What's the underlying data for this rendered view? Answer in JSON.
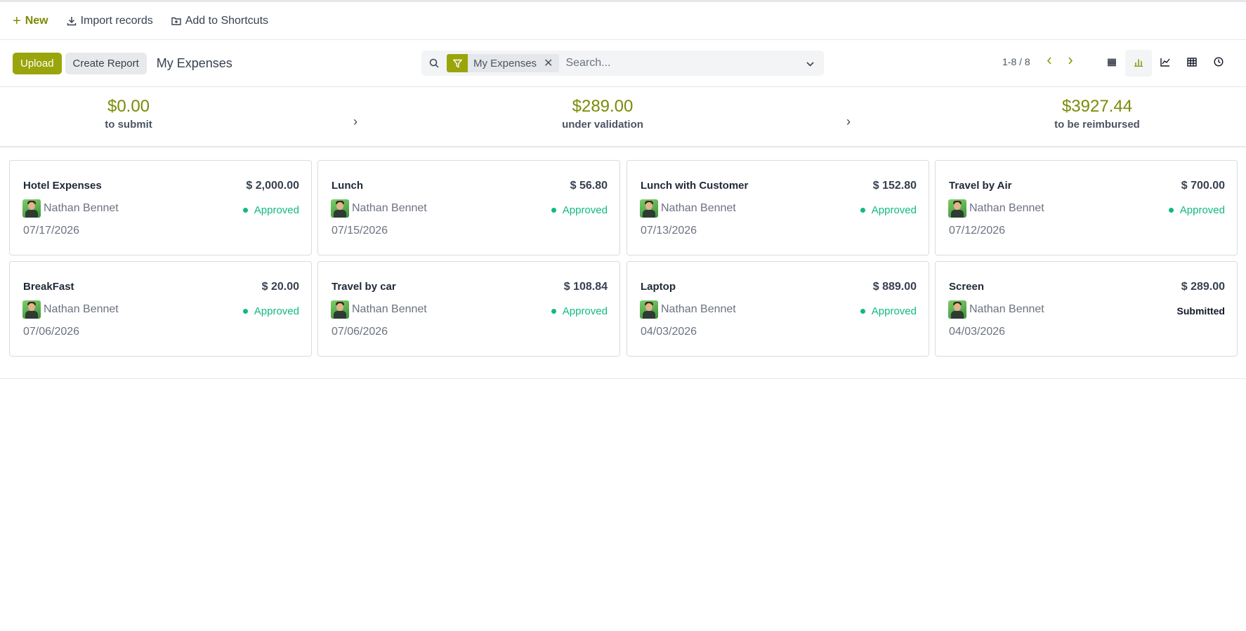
{
  "topbar": {
    "new_label": "New",
    "import_label": "Import records",
    "shortcuts_label": "Add to Shortcuts"
  },
  "controls": {
    "upload_label": "Upload",
    "create_report_label": "Create Report",
    "title": "My Expenses"
  },
  "search": {
    "facet_label": "My Expenses",
    "placeholder": "Search..."
  },
  "pager": {
    "value": "1-8 / 8"
  },
  "views": [
    "list-view-icon",
    "kanban-view-icon",
    "graph-view-icon",
    "pivot-view-icon",
    "activity-view-icon"
  ],
  "summary": [
    {
      "amount": "$0.00",
      "label": "to submit"
    },
    {
      "amount": "$289.00",
      "label": "under validation"
    },
    {
      "amount": "$3927.44",
      "label": "to be reimbursed"
    }
  ],
  "colors": {
    "accent": "#9aa50c",
    "approved": "#10b981"
  },
  "expenses": [
    {
      "title": "Hotel Expenses",
      "amount": "$ 2,000.00",
      "employee": "Nathan Bennet",
      "status": "Approved",
      "date": "07/17/2026"
    },
    {
      "title": "Lunch",
      "amount": "$ 56.80",
      "employee": "Nathan Bennet",
      "status": "Approved",
      "date": "07/15/2026"
    },
    {
      "title": "Lunch with Customer",
      "amount": "$ 152.80",
      "employee": "Nathan Bennet",
      "status": "Approved",
      "date": "07/13/2026"
    },
    {
      "title": "Travel by Air",
      "amount": "$ 700.00",
      "employee": "Nathan Bennet",
      "status": "Approved",
      "date": "07/12/2026"
    },
    {
      "title": "BreakFast",
      "amount": "$ 20.00",
      "employee": "Nathan Bennet",
      "status": "Approved",
      "date": "07/06/2026"
    },
    {
      "title": "Travel by car",
      "amount": "$ 108.84",
      "employee": "Nathan Bennet",
      "status": "Approved",
      "date": "07/06/2026"
    },
    {
      "title": "Laptop",
      "amount": "$ 889.00",
      "employee": "Nathan Bennet",
      "status": "Approved",
      "date": "04/03/2026"
    },
    {
      "title": "Screen",
      "amount": "$ 289.00",
      "employee": "Nathan Bennet",
      "status": "Submitted",
      "date": "04/03/2026"
    }
  ]
}
